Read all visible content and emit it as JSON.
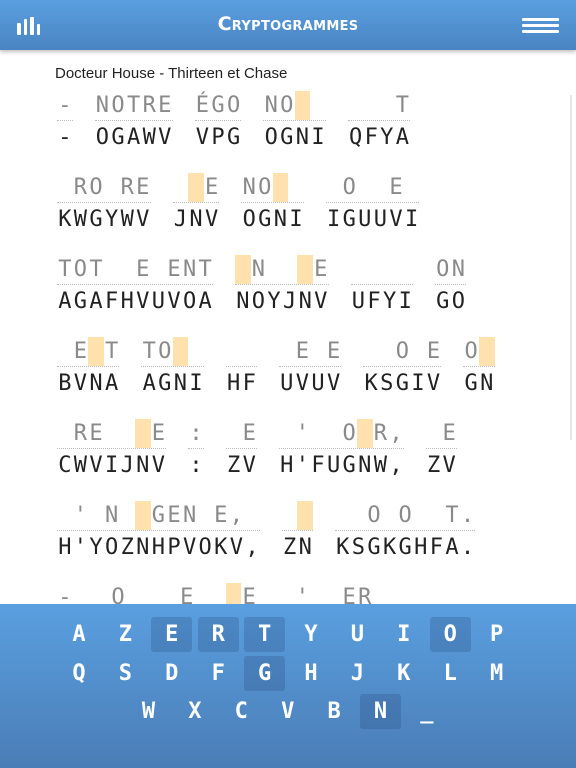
{
  "header": {
    "title": "Cryptogrammes",
    "left_icon": "stats-icon",
    "right_icon": "menu-icon"
  },
  "puzzle": {
    "title": "Docteur House - Thirteen et Chase",
    "selected_cipher_letter": "N",
    "highlight_color": "#ffe1ad",
    "lines": [
      [
        {
          "c": "-",
          "g": "-"
        },
        {
          "c": "OGAWV",
          "g": "NOTRE"
        },
        {
          "c": "VPG",
          "g": "ÉGO"
        },
        {
          "c": "OGNI",
          "g": "NO  "
        },
        {
          "c": "QFYA",
          "g": "   T"
        }
      ],
      [
        {
          "c": "KWGYWV",
          "g": " RO RE"
        },
        {
          "c": "JNV",
          "g": "  E"
        },
        {
          "c": "OGNI",
          "g": "NO  "
        },
        {
          "c": "IGUUVI",
          "g": " O  E "
        }
      ],
      [
        {
          "c": "AGAFHVUVOA",
          "g": "TOT  E ENT"
        },
        {
          "c": "NOYJNV",
          "g": " N   E"
        },
        {
          "c": "UFYI",
          "g": "    "
        },
        {
          "c": "GO",
          "g": "ON"
        }
      ],
      [
        {
          "c": "BVNA",
          "g": " E T"
        },
        {
          "c": "AGNI",
          "g": "TO  "
        },
        {
          "c": "HF",
          "g": "  "
        },
        {
          "c": "UVUV",
          "g": " E E"
        },
        {
          "c": "KSGIV",
          "g": "  O E"
        },
        {
          "c": "GN",
          "g": "O "
        }
      ],
      [
        {
          "c": "CWVIJNV",
          "g": " RE   E"
        },
        {
          "c": ":",
          "g": ":"
        },
        {
          "c": "ZV",
          "g": " E"
        },
        {
          "c": "H'FUGNW,",
          "g": " '  O R,"
        },
        {
          "c": "ZV",
          "g": " E"
        }
      ],
      [
        {
          "c": "H'YOZNHPVOKV,",
          "g": " ' N  GEN E,"
        },
        {
          "c": "ZN",
          "g": "  "
        },
        {
          "c": "KSGKGHFA.",
          "g": "  O O  T."
        }
      ],
      [
        {
          "c": "",
          "g": "-"
        },
        {
          "c": "",
          "g": " O  ",
          "h": []
        },
        {
          "c": "",
          "g": "E   E",
          "h": [
            3
          ]
        },
        {
          "c": "",
          "g": " '  ER",
          "h": []
        }
      ]
    ]
  },
  "keyboard": {
    "rows": [
      [
        "A",
        "Z",
        "E",
        "R",
        "T",
        "Y",
        "U",
        "I",
        "O",
        "P"
      ],
      [
        "Q",
        "S",
        "D",
        "F",
        "G",
        "H",
        "J",
        "K",
        "L",
        "M"
      ],
      [
        "W",
        "X",
        "C",
        "V",
        "B",
        "N",
        "_"
      ]
    ],
    "used_letters": [
      "E",
      "R",
      "T",
      "O",
      "G",
      "N"
    ]
  }
}
